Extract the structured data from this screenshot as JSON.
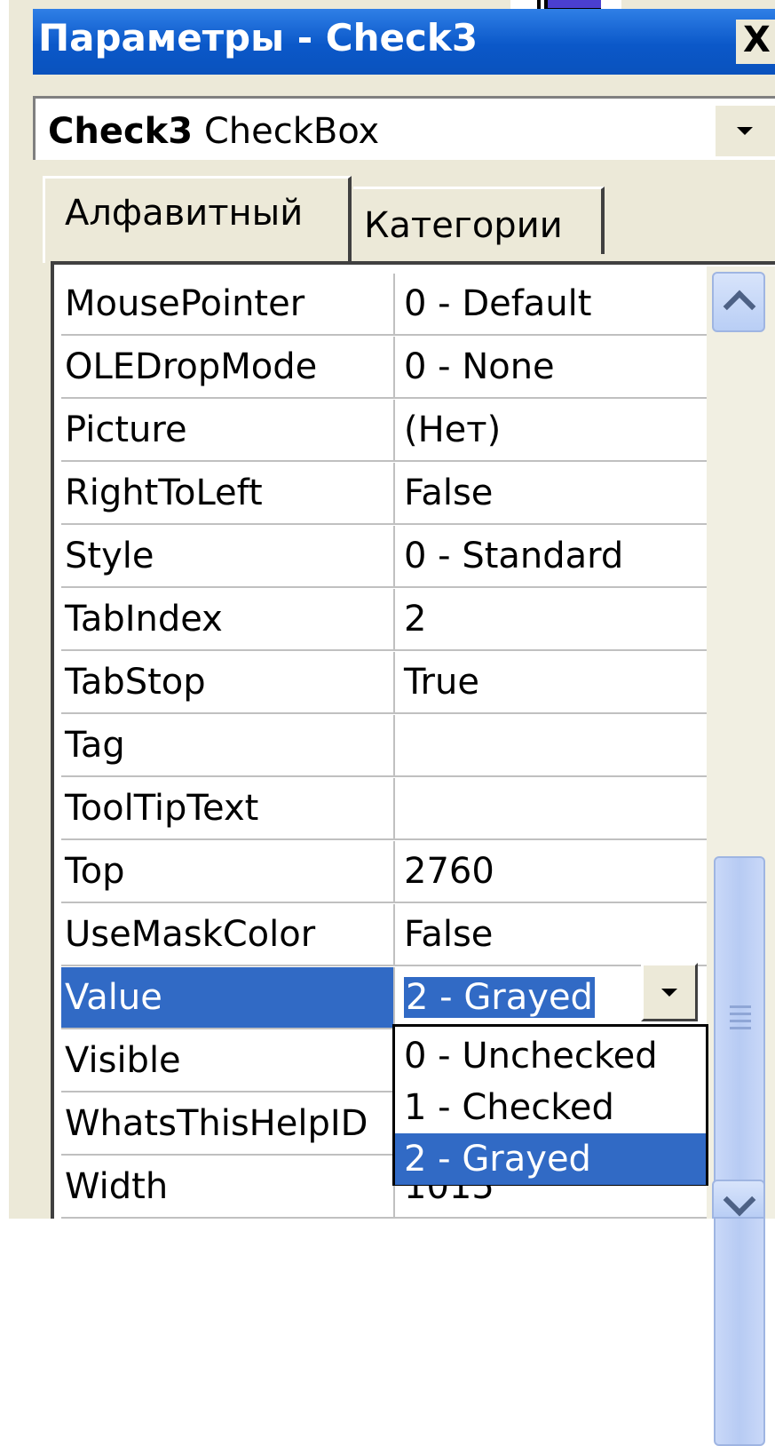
{
  "window": {
    "title": "Параметры - Check3",
    "close_label": "X"
  },
  "object_selector": {
    "object_name": "Check3",
    "object_type": "CheckBox"
  },
  "tabs": [
    {
      "label": "Алфавитный",
      "active": true
    },
    {
      "label": "Категории",
      "active": false
    }
  ],
  "properties": [
    {
      "name": "MousePointer",
      "value": "0 - Default"
    },
    {
      "name": "OLEDropMode",
      "value": "0 - None"
    },
    {
      "name": "Picture",
      "value": "(Нет)"
    },
    {
      "name": "RightToLeft",
      "value": "False"
    },
    {
      "name": "Style",
      "value": "0 - Standard"
    },
    {
      "name": "TabIndex",
      "value": "2"
    },
    {
      "name": "TabStop",
      "value": "True"
    },
    {
      "name": "Tag",
      "value": ""
    },
    {
      "name": "ToolTipText",
      "value": ""
    },
    {
      "name": "Top",
      "value": "2760"
    },
    {
      "name": "UseMaskColor",
      "value": "False"
    },
    {
      "name": "Value",
      "value": "2 - Grayed",
      "selected": true
    },
    {
      "name": "Visible",
      "value": ""
    },
    {
      "name": "WhatsThisHelpID",
      "value": ""
    },
    {
      "name": "Width",
      "value": "1015"
    }
  ],
  "value_dropdown": {
    "options": [
      "0 - Unchecked",
      "1 - Checked",
      "2 - Grayed"
    ],
    "selected": "2 - Grayed"
  },
  "icons": {
    "close": "close-icon",
    "dropdown": "chevron-down-icon",
    "scroll_up": "scroll-up-icon",
    "scroll_down": "scroll-down-icon"
  },
  "colors": {
    "titlebar": "#0a5fcf",
    "selection": "#316ac5",
    "panel": "#ece9d8"
  }
}
